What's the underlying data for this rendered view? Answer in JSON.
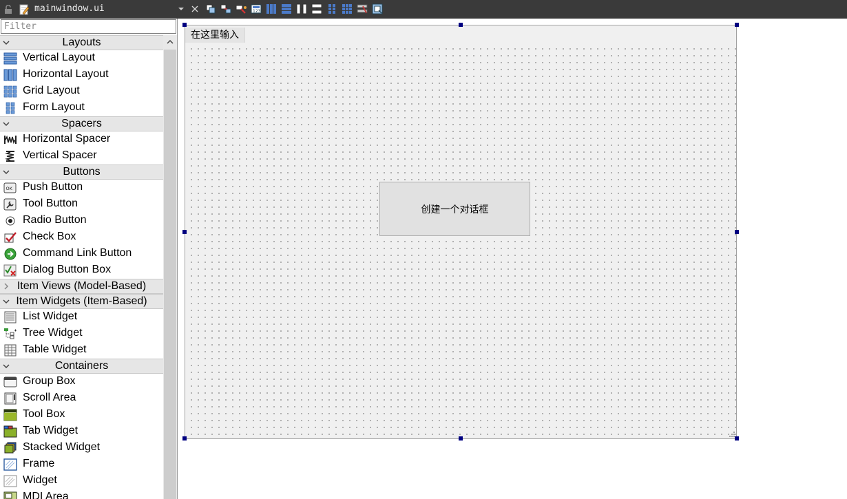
{
  "document": {
    "file_name": "mainwindow.ui"
  },
  "toolbar_icons": [
    "edit-widgets-icon",
    "edit-signals-slots-icon",
    "edit-buddies-icon",
    "edit-tab-order-icon",
    "layout-horizontal-icon",
    "layout-vertical-icon",
    "splitter-horizontal-icon",
    "splitter-vertical-icon",
    "layout-form-icon",
    "layout-grid-icon",
    "break-layout-icon",
    "adjust-size-icon"
  ],
  "widget_box": {
    "filter_placeholder": "Filter",
    "categories": {
      "layouts": {
        "label": "Layouts",
        "items": [
          "Vertical Layout",
          "Horizontal Layout",
          "Grid Layout",
          "Form Layout"
        ]
      },
      "spacers": {
        "label": "Spacers",
        "items": [
          "Horizontal Spacer",
          "Vertical Spacer"
        ]
      },
      "buttons": {
        "label": "Buttons",
        "items": [
          "Push Button",
          "Tool Button",
          "Radio Button",
          "Check Box",
          "Command Link Button",
          "Dialog Button Box"
        ]
      },
      "item_views": {
        "label": "Item Views (Model-Based)",
        "collapsed": true
      },
      "item_widgets": {
        "label": "Item Widgets (Item-Based)",
        "items": [
          "List Widget",
          "Tree Widget",
          "Table Widget"
        ]
      },
      "containers": {
        "label": "Containers",
        "items": [
          "Group Box",
          "Scroll Area",
          "Tool Box",
          "Tab Widget",
          "Stacked Widget",
          "Frame",
          "Widget",
          "MDI Area"
        ]
      }
    }
  },
  "form": {
    "menu_placeholder": "在这里输入",
    "button_label": "创建一个对话框"
  },
  "colors": {
    "topbar": "#3a3a3a",
    "selection_handle": "#000080",
    "form_background": "#f0f0f0",
    "category_header": "#e6e6e6"
  }
}
